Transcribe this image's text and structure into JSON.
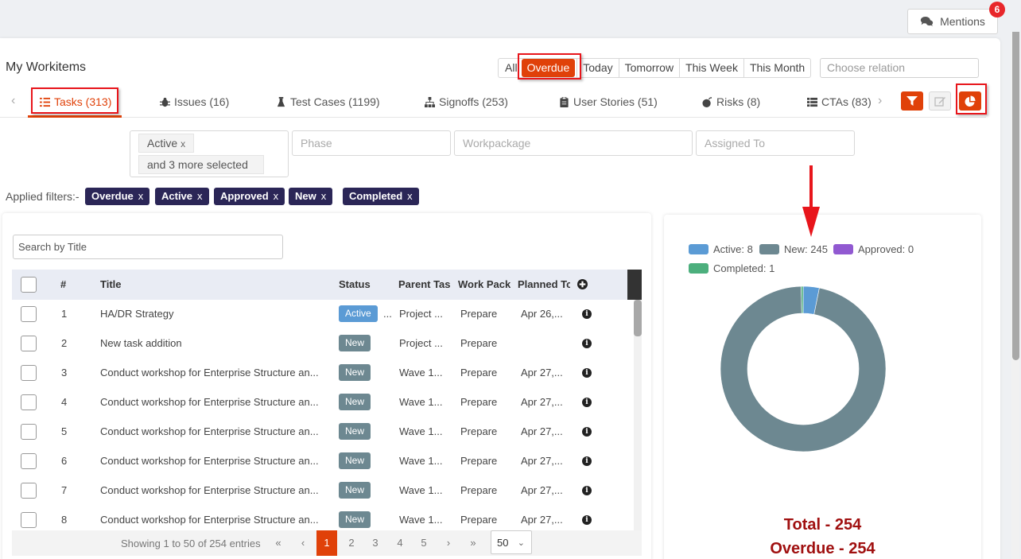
{
  "header": {
    "mentions_label": "Mentions",
    "mentions_count": "6"
  },
  "page_title": "My Workitems",
  "date_filters": {
    "options": [
      "All",
      "Overdue",
      "Today",
      "Tomorrow",
      "This Week",
      "This Month"
    ],
    "selected": "Overdue"
  },
  "relation_select": {
    "placeholder": "Choose relation"
  },
  "tabs": [
    {
      "label": "Tasks (313)",
      "icon": "tasks-list-icon",
      "active": true
    },
    {
      "label": "Issues (16)",
      "icon": "bug-icon",
      "active": false
    },
    {
      "label": "Test Cases (1199)",
      "icon": "flask-icon",
      "active": false
    },
    {
      "label": "Signoffs (253)",
      "icon": "sitemap-icon",
      "active": false
    },
    {
      "label": "User Stories (51)",
      "icon": "clipboard-icon",
      "active": false
    },
    {
      "label": "Risks (8)",
      "icon": "bomb-icon",
      "active": false
    },
    {
      "label": "CTAs (83)",
      "icon": "table-list-icon",
      "active": false
    }
  ],
  "toolbar_icons": [
    "filter-icon",
    "edit-icon",
    "pie-chart-icon"
  ],
  "filters": {
    "status_chip": "Active",
    "status_more": "and 3 more selected",
    "phase_placeholder": "Phase",
    "workpackage_placeholder": "Workpackage",
    "assigned_placeholder": "Assigned To"
  },
  "applied_filters": {
    "label": "Applied filters:-",
    "tags": [
      "Overdue",
      "Active",
      "Approved",
      "New",
      "Completed"
    ]
  },
  "table": {
    "search_placeholder": "Search by Title",
    "columns": [
      "#",
      "Title",
      "Status",
      "Parent Task",
      "Work Package",
      "Planned To"
    ],
    "column_display": [
      "#",
      "Title",
      "Status",
      "Parent Tas",
      "Work Pack",
      "Planned Tc"
    ],
    "rows": [
      {
        "num": "1",
        "title": "HA/DR Strategy",
        "status": "Active",
        "extra": "...",
        "parent": "Project ...",
        "workpackage": "Prepare",
        "planned": "Apr 26,..."
      },
      {
        "num": "2",
        "title": "New task addition",
        "status": "New",
        "extra": "",
        "parent": "Project ...",
        "workpackage": "Prepare",
        "planned": ""
      },
      {
        "num": "3",
        "title": "Conduct workshop for Enterprise Structure an...",
        "status": "New",
        "extra": "",
        "parent": "Wave 1...",
        "workpackage": "Prepare",
        "planned": "Apr 27,..."
      },
      {
        "num": "4",
        "title": "Conduct workshop for Enterprise Structure an...",
        "status": "New",
        "extra": "",
        "parent": "Wave 1...",
        "workpackage": "Prepare",
        "planned": "Apr 27,..."
      },
      {
        "num": "5",
        "title": "Conduct workshop for Enterprise Structure an...",
        "status": "New",
        "extra": "",
        "parent": "Wave 1...",
        "workpackage": "Prepare",
        "planned": "Apr 27,..."
      },
      {
        "num": "6",
        "title": "Conduct workshop for Enterprise Structure an...",
        "status": "New",
        "extra": "",
        "parent": "Wave 1...",
        "workpackage": "Prepare",
        "planned": "Apr 27,..."
      },
      {
        "num": "7",
        "title": "Conduct workshop for Enterprise Structure an...",
        "status": "New",
        "extra": "",
        "parent": "Wave 1...",
        "workpackage": "Prepare",
        "planned": "Apr 27,..."
      },
      {
        "num": "8",
        "title": "Conduct workshop for Enterprise Structure an...",
        "status": "New",
        "extra": "",
        "parent": "Wave 1...",
        "workpackage": "Prepare",
        "planned": "Apr 27,..."
      }
    ]
  },
  "pagination": {
    "info": "Showing 1 to 50 of 254 entries",
    "first": "«",
    "prev": "‹",
    "pages": [
      "1",
      "2",
      "3",
      "4",
      "5"
    ],
    "current": "1",
    "next": "›",
    "last": "»",
    "page_size": "50"
  },
  "colors": {
    "accent": "#e04109",
    "tag_bg": "#2b2657",
    "active": "#5b9bd5",
    "new": "#6d8891",
    "approved": "#9159d1",
    "completed": "#4caf7d",
    "total_text": "#a01010"
  },
  "chart_data": {
    "type": "pie",
    "variant": "doughnut",
    "title": "",
    "legend_position": "top",
    "series": [
      {
        "name": "Active",
        "value": 8,
        "label": "Active: 8",
        "color": "#5b9bd5"
      },
      {
        "name": "New",
        "value": 245,
        "label": "New: 245",
        "color": "#6d8891"
      },
      {
        "name": "Approved",
        "value": 0,
        "label": "Approved: 0",
        "color": "#9159d1"
      },
      {
        "name": "Completed",
        "value": 1,
        "label": "Completed: 1",
        "color": "#4caf7d"
      }
    ],
    "total_label": "Total - 254",
    "overdue_label": "Overdue - 254"
  }
}
